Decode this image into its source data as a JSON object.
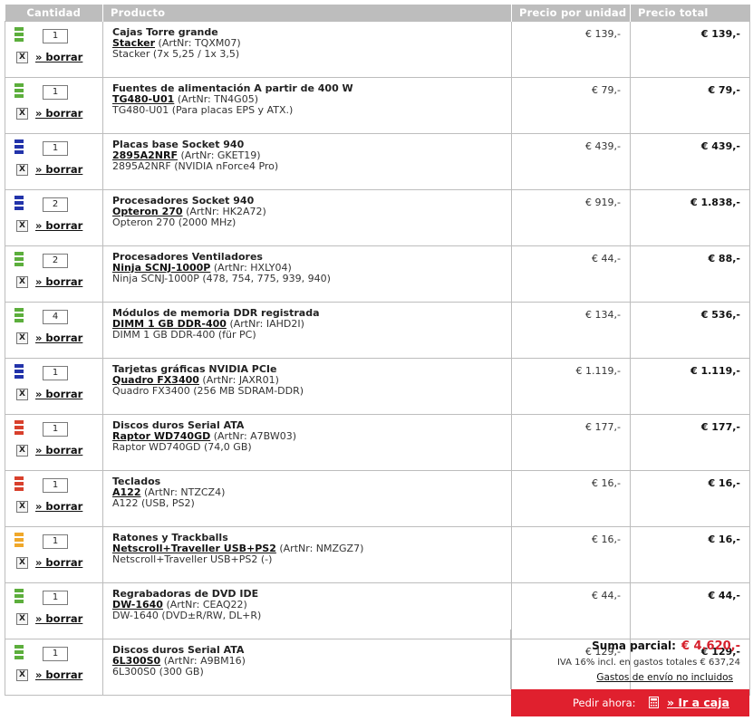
{
  "headers": {
    "quantity": "Cantidad",
    "product": "Producto",
    "unit_price": "Precio por unidad",
    "total_price": "Precio total"
  },
  "delete_label": "» borrar",
  "delete_box": "X",
  "items": [
    {
      "category": "Cajas Torre grande",
      "model": "Stacker",
      "artnr": "(ArtNr: TQXM07)",
      "desc": "Stacker (7x 5,25 / 1x 3,5)",
      "qty": "1",
      "unit_price": "€ 139,-",
      "total": "€ 139,-",
      "status_color": "#5cae3c"
    },
    {
      "category": "Fuentes de alimentación A partir de 400 W",
      "model": "TG480-U01",
      "artnr": "(ArtNr: TN4G05)",
      "desc": "TG480-U01 (Para placas EPS y ATX.)",
      "qty": "1",
      "unit_price": "€ 79,-",
      "total": "€ 79,-",
      "status_color": "#5cae3c"
    },
    {
      "category": "Placas base Socket 940",
      "model": "2895A2NRF",
      "artnr": "(ArtNr: GKET19)",
      "desc": "2895A2NRF (NVIDIA nForce4 Pro)",
      "qty": "1",
      "unit_price": "€ 439,-",
      "total": "€ 439,-",
      "status_color": "#2233aa"
    },
    {
      "category": "Procesadores Socket 940",
      "model": "Opteron 270",
      "artnr": "(ArtNr: HK2A72)",
      "desc": "Opteron 270 (2000 MHz)",
      "qty": "2",
      "unit_price": "€ 919,-",
      "total": "€ 1.838,-",
      "status_color": "#2233aa"
    },
    {
      "category": "Procesadores Ventiladores",
      "model": "Ninja SCNJ-1000P",
      "artnr": "(ArtNr: HXLY04)",
      "desc": "Ninja SCNJ-1000P (478, 754, 775, 939, 940)",
      "qty": "2",
      "unit_price": "€ 44,-",
      "total": "€ 88,-",
      "status_color": "#5cae3c"
    },
    {
      "category": "Módulos de memoria DDR registrada",
      "model": "DIMM 1 GB DDR-400",
      "artnr": "(ArtNr: IAHD2I)",
      "desc": "DIMM 1 GB DDR-400 (für PC)",
      "qty": "4",
      "unit_price": "€ 134,-",
      "total": "€ 536,-",
      "status_color": "#5cae3c"
    },
    {
      "category": "Tarjetas gráficas NVIDIA PCIe",
      "model": "Quadro FX3400",
      "artnr": "(ArtNr: JAXR01)",
      "desc": "Quadro FX3400 (256 MB SDRAM-DDR)",
      "qty": "1",
      "unit_price": "€ 1.119,-",
      "total": "€ 1.119,-",
      "status_color": "#2233aa"
    },
    {
      "category": "Discos duros Serial ATA",
      "model": "Raptor WD740GD",
      "artnr": "(ArtNr: A7BW03)",
      "desc": "Raptor WD740GD (74,0 GB)",
      "qty": "1",
      "unit_price": "€ 177,-",
      "total": "€ 177,-",
      "status_color": "#d8402c"
    },
    {
      "category": "Teclados",
      "model": "A122",
      "artnr": "(ArtNr: NTZCZ4)",
      "desc": "A122 (USB, PS2)",
      "qty": "1",
      "unit_price": "€ 16,-",
      "total": "€ 16,-",
      "status_color": "#d8402c"
    },
    {
      "category": "Ratones y Trackballs",
      "model": "Netscroll+Traveller USB+PS2",
      "artnr": "(ArtNr: NMZGZ7)",
      "desc": "Netscroll+Traveller USB+PS2 (-)",
      "qty": "1",
      "unit_price": "€ 16,-",
      "total": "€ 16,-",
      "status_color": "#f0a82a"
    },
    {
      "category": "Regrabadoras de DVD IDE",
      "model": "DW-1640",
      "artnr": "(ArtNr: CEAQ22)",
      "desc": "DW-1640 (DVD±R/RW, DL+R)",
      "qty": "1",
      "unit_price": "€ 44,-",
      "total": "€ 44,-",
      "status_color": "#5cae3c"
    },
    {
      "category": "Discos duros Serial ATA",
      "model": "6L300S0",
      "artnr": "(ArtNr: A9BM16)",
      "desc": "6L300S0 (300 GB)",
      "qty": "1",
      "unit_price": "€ 129,-",
      "total": "€ 129,-",
      "status_color": "#5cae3c"
    }
  ],
  "summary": {
    "subtotal_label": "Suma parcial:",
    "subtotal_value": "€ 4.620,-",
    "vat_text": "IVA 16% incl. en gastos totales € 637,24",
    "shipping_text": "Gastos de envío no incluidos"
  },
  "checkout": {
    "order_label": "Pedir ahora:",
    "checkout_link": "» Ir a caja",
    "accent_color": "#e0202e"
  }
}
